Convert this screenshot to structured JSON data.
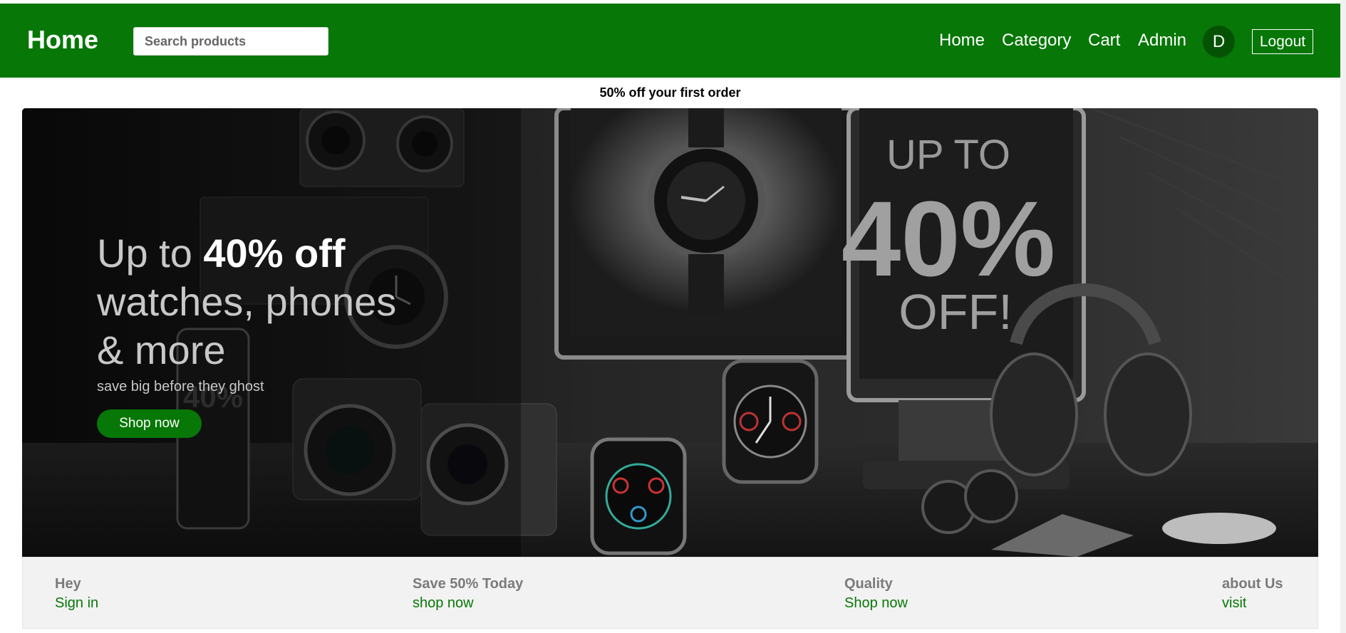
{
  "navbar": {
    "brand": "Home",
    "search_placeholder": "Search products",
    "links": [
      "Home",
      "Category",
      "Cart",
      "Admin"
    ],
    "avatar_initial": "D",
    "logout_label": "Logout",
    "bg_color": "#077707"
  },
  "promo": {
    "text": "50% off your first order"
  },
  "hero": {
    "line1_normal": "Up to ",
    "line1_strong": "40% off",
    "line2": "watches, phones",
    "line3": "& more",
    "subtitle": "save big before they ghost",
    "cta": "Shop now",
    "image_sign": [
      "UP TO",
      "40%",
      "OFF!"
    ]
  },
  "footer": {
    "columns": [
      {
        "title": "Hey",
        "link": "Sign in"
      },
      {
        "title": "Save 50% Today",
        "link": "shop now"
      },
      {
        "title": "Quality",
        "link": "Shop now"
      },
      {
        "title": "about Us",
        "link": "visit"
      }
    ]
  }
}
